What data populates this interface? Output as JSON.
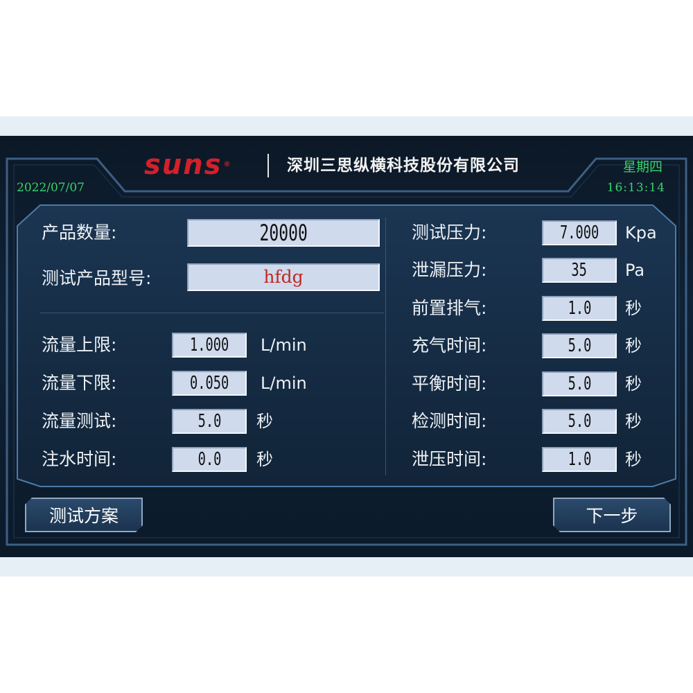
{
  "header": {
    "logo_text": "suns",
    "company": "深圳三思纵横科技股份有限公司",
    "date": "2022/07/07",
    "weekday": "星期四",
    "time": "16:13:14"
  },
  "product": {
    "quantity_label": "产品数量:",
    "quantity_value": "20000",
    "model_label": "测试产品型号:",
    "model_value": "hfdg"
  },
  "left_params": [
    {
      "label": "流量上限:",
      "value": "1.000",
      "unit": "L/min"
    },
    {
      "label": "流量下限:",
      "value": "0.050",
      "unit": "L/min"
    },
    {
      "label": "流量测试:",
      "value": "5.0",
      "unit": "秒"
    },
    {
      "label": "注水时间:",
      "value": "0.0",
      "unit": "秒"
    }
  ],
  "right_params": [
    {
      "label": "测试压力:",
      "value": "7.000",
      "unit": "Kpa"
    },
    {
      "label": "泄漏压力:",
      "value": "35",
      "unit": "Pa"
    },
    {
      "label": "前置排气:",
      "value": "1.0",
      "unit": "秒"
    },
    {
      "label": "充气时间:",
      "value": "5.0",
      "unit": "秒"
    },
    {
      "label": "平衡时间:",
      "value": "5.0",
      "unit": "秒"
    },
    {
      "label": "检测时间:",
      "value": "5.0",
      "unit": "秒"
    },
    {
      "label": "泄压时间:",
      "value": "1.0",
      "unit": "秒"
    }
  ],
  "buttons": {
    "test_plan": "测试方案",
    "next_step": "下一步"
  },
  "colors": {
    "logo_red": "#d3202a",
    "clock_green": "#39d36b",
    "value_bg": "#cfdaec",
    "model_red": "#c0271f"
  }
}
